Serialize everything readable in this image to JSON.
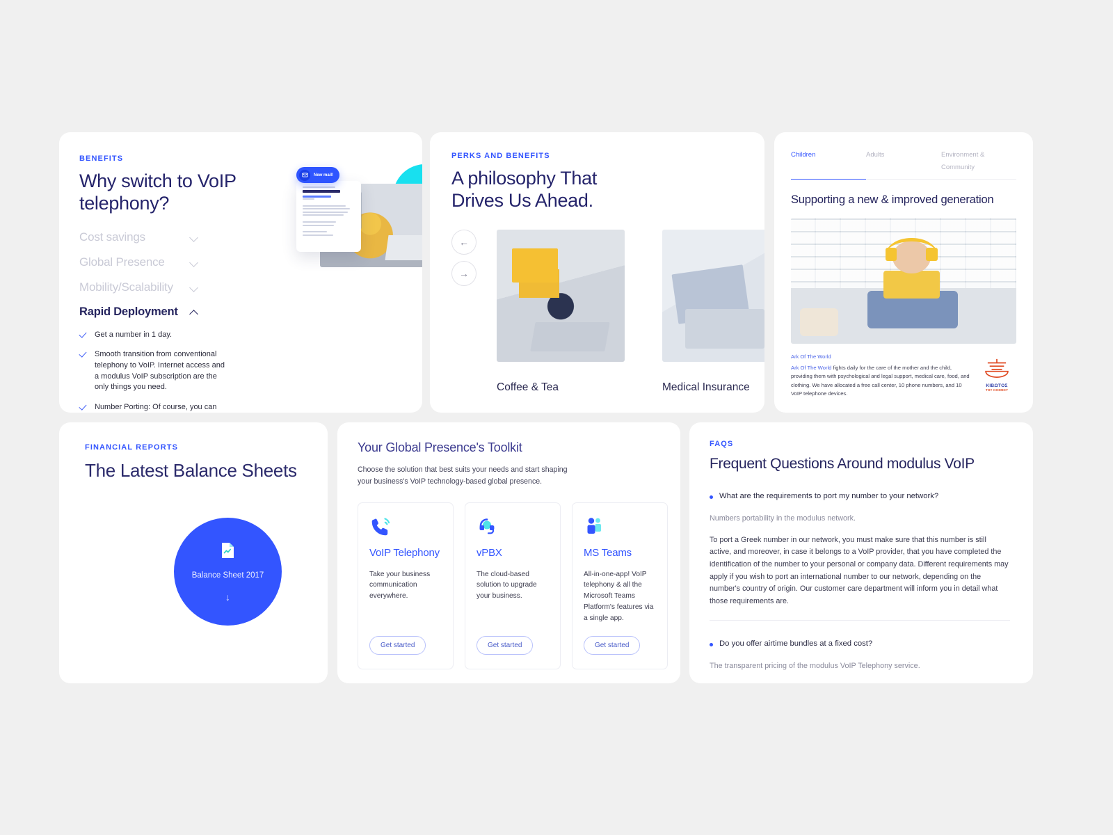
{
  "theme": {
    "accent": "#3355ff",
    "ink": "#26255f",
    "cyan": "#18e0ef",
    "bg": "#f0f0f0"
  },
  "benefits": {
    "eyebrow": "BENEFITS",
    "heading": "Why switch to VoIP telephony?",
    "accordion": [
      {
        "label": "Cost savings",
        "open": false
      },
      {
        "label": "Global Presence",
        "open": false
      },
      {
        "label": "Mobility/Scalability",
        "open": false
      },
      {
        "label": "Rapid Deployment",
        "open": true
      }
    ],
    "checklist": [
      "Get a number in 1 day.",
      "Smooth transition from conventional telephony to VoIP. Internet access and a modulus VoIP subscription are the only things you need.",
      "Number Porting: Of course, you can maintain your phone numbers and transfer them to the modulus network."
    ],
    "mail_badge": "New mail!",
    "mail_subject": "ORDER CONFIRMATION"
  },
  "perks": {
    "eyebrow": "PERKS AND BENEFITS",
    "heading": "A philosophy That Drives Us Ahead.",
    "prev": "←",
    "next": "→",
    "slides": [
      {
        "caption": "Coffee & Tea"
      },
      {
        "caption": "Medical Insurance"
      }
    ]
  },
  "support": {
    "tabs": [
      {
        "label": "Children",
        "active": true
      },
      {
        "label": "Adults",
        "active": false
      },
      {
        "label": "Environment & Community",
        "active": false
      }
    ],
    "title": "Supporting a new & improved generation",
    "org_name": "Ark Of The World",
    "body_link": "Ark Of The World",
    "body_rest": " fights daily for the care of the mother and the child, providing them with psychological and legal support, medical care, food, and clothing. We have allocated a free call center, 10 phone numbers, and 10 VoIP telephone devices.",
    "logo_line1": "ΚΙΒΩΤΟΣ",
    "logo_line2": "ΤΟΥ ΚΟΣΜΟΥ"
  },
  "balance": {
    "eyebrow": "FINANCIAL REPORTS",
    "heading": "The Latest Balance Sheets",
    "file_label": "Balance Sheet 2017",
    "download_glyph": "↓"
  },
  "toolkit": {
    "title": "Your Global Presence's Toolkit",
    "subtitle": "Choose the solution that best suits your needs and start shaping your business's VoIP technology-based global presence.",
    "tiles": [
      {
        "icon": "phone-icon",
        "name": "VoIP Telephony",
        "desc": "Take your business communication everywhere.",
        "cta": "Get started"
      },
      {
        "icon": "headset-icon",
        "name": "vPBX",
        "desc": "The cloud-based solution to upgrade your business.",
        "cta": "Get started"
      },
      {
        "icon": "teams-icon",
        "name": "MS Teams",
        "desc": "All-in-one-app! VoIP telephony & all the Microsoft Teams Platform's features via a single app.",
        "cta": "Get started"
      }
    ]
  },
  "faq": {
    "eyebrow": "FAQS",
    "heading": "Frequent Questions Around modulus VoIP",
    "items": [
      {
        "question": "What are the requirements to port my number to your network?",
        "toggle": "−",
        "open": true,
        "lead": "Numbers portability in the modulus network.",
        "body": "To port a Greek number in our network, you must make sure that this number is still active, and moreover, in case it belongs to a VoIP provider, that you have completed the identification of the number to your personal or company data. Different requirements may apply if you wish to port an international number to our network, depending on the number's country of origin. Our customer care department will inform you in detail what those requirements are."
      },
      {
        "question": "Do you offer airtime bundles at a fixed cost?",
        "toggle": "+",
        "open": false,
        "lead": "The transparent pricing of the modulus VoIP Telephony service.",
        "body": ""
      }
    ]
  }
}
